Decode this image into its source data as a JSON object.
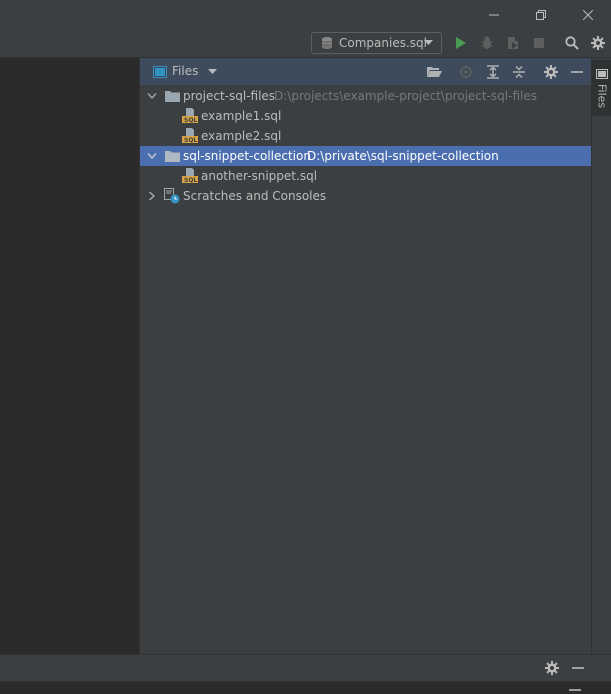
{
  "window": {
    "controls": [
      "minimize-icon",
      "restore-icon",
      "close-icon"
    ]
  },
  "toolbar": {
    "run_config": {
      "label": "Companies.sql",
      "icon": "database-icon"
    },
    "actions": [
      "run-icon",
      "debug-icon",
      "coverage-icon",
      "stop-icon",
      "search-icon",
      "settings-icon"
    ]
  },
  "files_panel": {
    "title": "Files",
    "header_actions": [
      "open-folder-icon",
      "locate-icon",
      "expand-all-icon",
      "collapse-all-icon",
      "gear-icon",
      "minimize-panel-icon"
    ],
    "tree": [
      {
        "name": "project-sql-files",
        "path": "D:\\projects\\example-project\\project-sql-files",
        "type": "folder",
        "expanded": true,
        "selected": false
      },
      {
        "name": "example1.sql",
        "type": "sql-file"
      },
      {
        "name": "example2.sql",
        "type": "sql-file"
      },
      {
        "name": "sql-snippet-collection",
        "path": "D:\\private\\sql-snippet-collection",
        "type": "folder",
        "expanded": true,
        "selected": true
      },
      {
        "name": "another-snippet.sql",
        "type": "sql-file"
      },
      {
        "name": "Scratches and Consoles",
        "type": "scratches",
        "expanded": false
      }
    ]
  },
  "side_tab": {
    "label": "Files"
  },
  "colors": {
    "background": "#3c3f41",
    "editor": "#2b2b2b",
    "header_active": "#3d4b5c",
    "selection": "#4b6eaf",
    "run_green": "#499c54",
    "sql_orange": "#d9a343"
  }
}
